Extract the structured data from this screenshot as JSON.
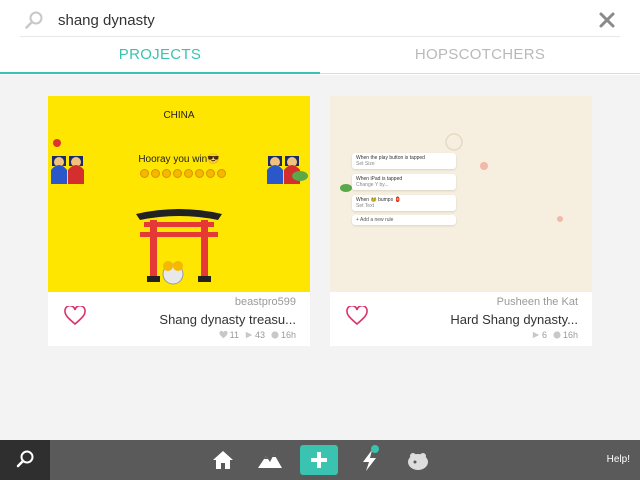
{
  "search": {
    "value": "shang dynasty",
    "placeholder": ""
  },
  "tabs": [
    {
      "label": "PROJECTS",
      "active": true
    },
    {
      "label": "HOPSCOTCHERS",
      "active": false
    }
  ],
  "colors": {
    "accent": "#3ac3b0",
    "inactive_tab": "#b9b9b9",
    "toolbar": "#5a5a5a",
    "heart": "#d9346b",
    "card1_thumb": "#ffe600"
  },
  "projects": [
    {
      "author": "beastpro599",
      "title": "Shang dynasty treasu...",
      "likes": "11",
      "plays": "43",
      "age": "16h",
      "thumb_texts": {
        "heading": "CHINA",
        "message": "Hooray you win😎"
      }
    },
    {
      "author": "Pusheen the Kat",
      "title": "Hard Shang dynasty...",
      "plays": "6",
      "age": "16h",
      "rules": [
        {
          "title": "When the play button is tapped",
          "action": "Set Size"
        },
        {
          "title": "When iPad is tapped",
          "action": "Change Y by..."
        },
        {
          "title": "When 🐸 bumps 🏮",
          "action": "Set Text"
        },
        {
          "title": "+ Add a new rule",
          "action": ""
        }
      ]
    }
  ],
  "toolbar": {
    "help_label": "Help!",
    "icons": [
      "search-icon",
      "home-icon",
      "mountains-icon",
      "plus-icon",
      "lightning-icon",
      "hopscotch-frog-icon"
    ]
  }
}
